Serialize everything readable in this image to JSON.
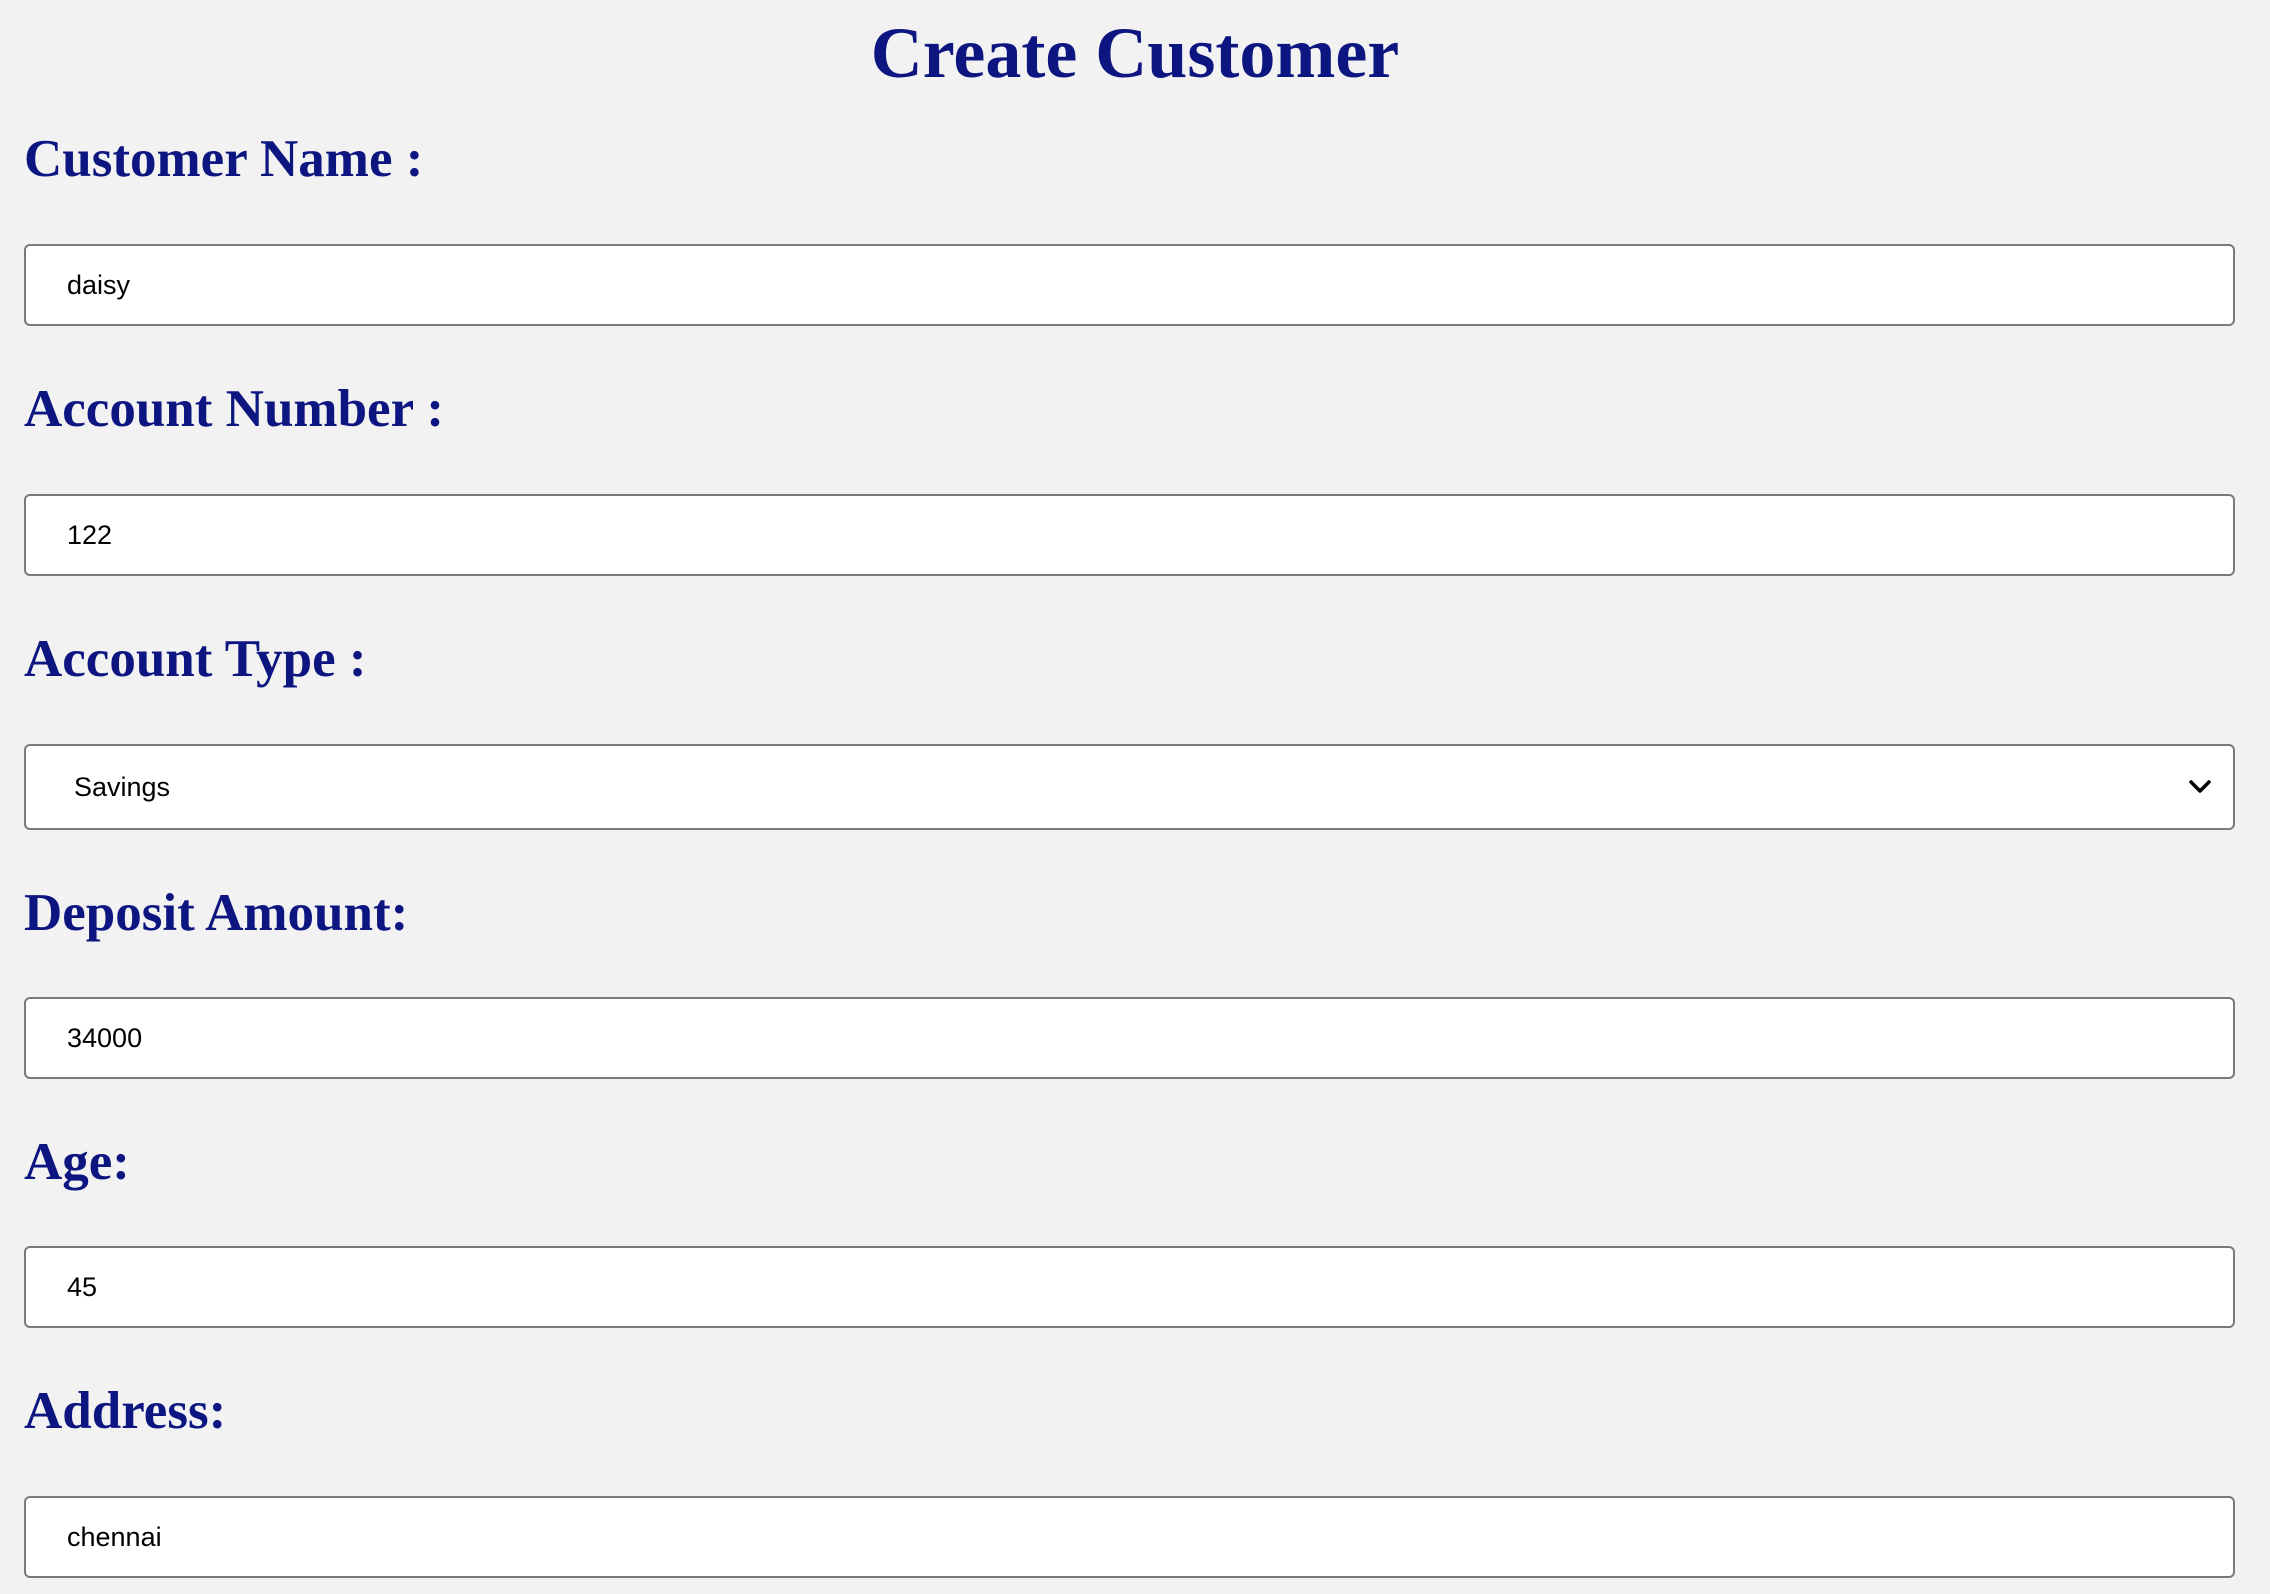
{
  "page": {
    "title": "Create Customer"
  },
  "form": {
    "customer_name": {
      "label": "Customer Name :",
      "value": "daisy"
    },
    "account_number": {
      "label": "Account Number :",
      "value": "122"
    },
    "account_type": {
      "label": "Account Type :",
      "value": "Savings"
    },
    "deposit_amount": {
      "label": "Deposit Amount:",
      "value": "34000"
    },
    "age": {
      "label": "Age:",
      "value": "45"
    },
    "address": {
      "label": "Address:",
      "value": "chennai"
    }
  },
  "icons": {
    "select_chevron": "chevron-down-icon"
  },
  "colors": {
    "heading": "#0d1580",
    "background": "#f2f2f2",
    "input_background": "#ffffff",
    "input_border": "#7a7a7a"
  }
}
